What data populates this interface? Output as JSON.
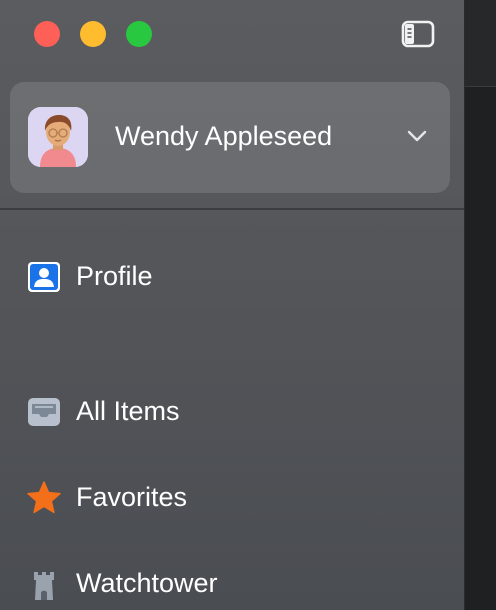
{
  "window": {
    "controls": {
      "close_color": "#fe5f57",
      "minimize_color": "#febc2e",
      "zoom_color": "#28c840"
    },
    "toolbar": {
      "sidebar_toggle_icon": "sidebar-toggle-icon"
    }
  },
  "account": {
    "name": "Wendy Appleseed",
    "avatar_icon": "user-avatar",
    "dropdown_icon": "chevron-down-icon"
  },
  "sidebar": {
    "items": [
      {
        "label": "Profile",
        "icon": "person-card-icon",
        "icon_color": "#1a73e8"
      },
      {
        "label": "All Items",
        "icon": "tray-icon",
        "icon_color": "#aab4c2"
      },
      {
        "label": "Favorites",
        "icon": "star-icon",
        "icon_color": "#f36f1a"
      },
      {
        "label": "Watchtower",
        "icon": "tower-icon",
        "icon_color": "#9aa3ad"
      }
    ]
  },
  "colors": {
    "sidebar_bg": "#55575b",
    "text": "#ffffff",
    "account_card_bg": "rgba(255,255,255,0.12)"
  }
}
